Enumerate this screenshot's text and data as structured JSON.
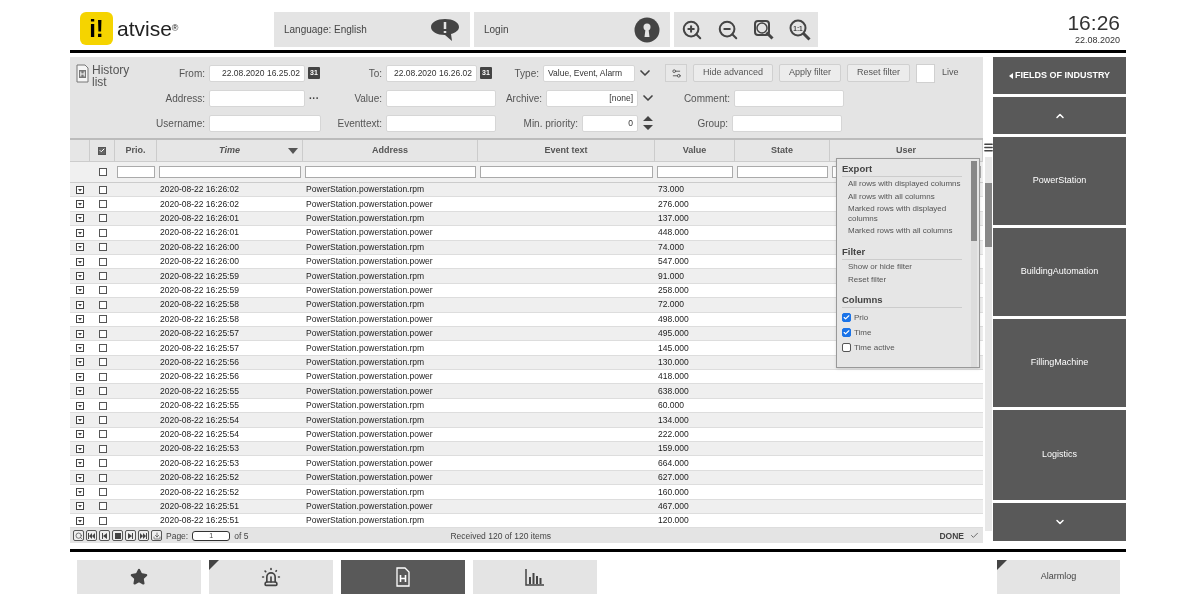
{
  "header": {
    "logo_mark": "i!",
    "logo_text": "atvise",
    "logo_reg": "®",
    "language": "Language: English",
    "login": "Login",
    "zoom_actual_label": "1:1",
    "time": "16:26",
    "date": "22.08.2020"
  },
  "history": {
    "title": "History list",
    "filters": {
      "from": {
        "label": "From:",
        "value": "22.08.2020 16.25.02",
        "calendar": "31"
      },
      "to": {
        "label": "To:",
        "value": "22.08.2020 16.26.02",
        "calendar": "31"
      },
      "type": {
        "label": "Type:",
        "value": "Value, Event, Alarm"
      },
      "address": {
        "label": "Address:",
        "button": "···"
      },
      "value": {
        "label": "Value:"
      },
      "archive": {
        "label": "Archive:",
        "value": "[none]"
      },
      "comment": {
        "label": "Comment:"
      },
      "username": {
        "label": "Username:"
      },
      "eventtext": {
        "label": "Eventtext:"
      },
      "min_priority": {
        "label": "Min. priority:",
        "value": "0"
      },
      "group": {
        "label": "Group:"
      }
    },
    "buttons": [
      "Hide advanced",
      "Apply filter",
      "Reset filter"
    ],
    "live": {
      "label": "Live",
      "checked": false
    }
  },
  "table": {
    "columns": [
      {
        "label": "Prio.",
        "sorted": false
      },
      {
        "label": "Time",
        "sorted": true
      },
      {
        "label": "Address",
        "sorted": false
      },
      {
        "label": "Event text",
        "sorted": false
      },
      {
        "label": "Value",
        "sorted": false
      },
      {
        "label": "State",
        "sorted": false
      },
      {
        "label": "User",
        "sorted": false
      }
    ],
    "header_checked": true,
    "filter_checked": false,
    "rows": [
      {
        "checked": false,
        "time": "2020-08-22 16:26:02",
        "address": "PowerStation.powerstation.rpm",
        "value": "73.000"
      },
      {
        "checked": false,
        "time": "2020-08-22 16:26:02",
        "address": "PowerStation.powerstation.power",
        "value": "276.000"
      },
      {
        "checked": false,
        "time": "2020-08-22 16:26:01",
        "address": "PowerStation.powerstation.rpm",
        "value": "137.000"
      },
      {
        "checked": false,
        "time": "2020-08-22 16:26:01",
        "address": "PowerStation.powerstation.power",
        "value": "448.000"
      },
      {
        "checked": false,
        "time": "2020-08-22 16:26:00",
        "address": "PowerStation.powerstation.rpm",
        "value": "74.000"
      },
      {
        "checked": false,
        "time": "2020-08-22 16:26:00",
        "address": "PowerStation.powerstation.power",
        "value": "547.000"
      },
      {
        "checked": false,
        "time": "2020-08-22 16:25:59",
        "address": "PowerStation.powerstation.rpm",
        "value": "91.000"
      },
      {
        "checked": false,
        "time": "2020-08-22 16:25:59",
        "address": "PowerStation.powerstation.power",
        "value": "258.000"
      },
      {
        "checked": false,
        "time": "2020-08-22 16:25:58",
        "address": "PowerStation.powerstation.rpm",
        "value": "72.000"
      },
      {
        "checked": false,
        "time": "2020-08-22 16:25:58",
        "address": "PowerStation.powerstation.power",
        "value": "498.000"
      },
      {
        "checked": false,
        "time": "2020-08-22 16:25:57",
        "address": "PowerStation.powerstation.power",
        "value": "495.000"
      },
      {
        "checked": false,
        "time": "2020-08-22 16:25:57",
        "address": "PowerStation.powerstation.rpm",
        "value": "145.000"
      },
      {
        "checked": false,
        "time": "2020-08-22 16:25:56",
        "address": "PowerStation.powerstation.rpm",
        "value": "130.000"
      },
      {
        "checked": false,
        "time": "2020-08-22 16:25:56",
        "address": "PowerStation.powerstation.power",
        "value": "418.000"
      },
      {
        "checked": false,
        "time": "2020-08-22 16:25:55",
        "address": "PowerStation.powerstation.power",
        "value": "638.000"
      },
      {
        "checked": false,
        "time": "2020-08-22 16:25:55",
        "address": "PowerStation.powerstation.rpm",
        "value": "60.000"
      },
      {
        "checked": false,
        "time": "2020-08-22 16:25:54",
        "address": "PowerStation.powerstation.rpm",
        "value": "134.000"
      },
      {
        "checked": false,
        "time": "2020-08-22 16:25:54",
        "address": "PowerStation.powerstation.power",
        "value": "222.000"
      },
      {
        "checked": false,
        "time": "2020-08-22 16:25:53",
        "address": "PowerStation.powerstation.rpm",
        "value": "159.000"
      },
      {
        "checked": false,
        "time": "2020-08-22 16:25:53",
        "address": "PowerStation.powerstation.power",
        "value": "664.000"
      },
      {
        "checked": false,
        "time": "2020-08-22 16:25:52",
        "address": "PowerStation.powerstation.power",
        "value": "627.000"
      },
      {
        "checked": false,
        "time": "2020-08-22 16:25:52",
        "address": "PowerStation.powerstation.rpm",
        "value": "160.000"
      },
      {
        "checked": false,
        "time": "2020-08-22 16:25:51",
        "address": "PowerStation.powerstation.power",
        "value": "467.000"
      },
      {
        "checked": false,
        "time": "2020-08-22 16:25:51",
        "address": "PowerStation.powerstation.rpm",
        "value": "120.000"
      }
    ],
    "footer": {
      "page_label": "Page:",
      "page": "1",
      "of": "of 5",
      "status": "Received 120 of 120 items",
      "done": "DONE"
    }
  },
  "menu": {
    "sections": [
      {
        "title": "Export",
        "items": [
          {
            "kind": "action",
            "label": "All rows with displayed columns"
          },
          {
            "kind": "action",
            "label": "All rows with all columns"
          },
          {
            "kind": "action",
            "label": "Marked rows with displayed columns"
          },
          {
            "kind": "action",
            "label": "Marked rows with all columns"
          }
        ]
      },
      {
        "title": "Filter",
        "items": [
          {
            "kind": "action",
            "label": "Show or hide filter"
          },
          {
            "kind": "action",
            "label": "Reset filter"
          }
        ]
      },
      {
        "title": "Columns",
        "items": [
          {
            "kind": "checkbox",
            "label": "Prio",
            "checked": true
          },
          {
            "kind": "checkbox",
            "label": "Time",
            "checked": true
          },
          {
            "kind": "checkbox",
            "label": "Time active",
            "checked": false
          }
        ]
      }
    ]
  },
  "sidebar": {
    "header": "FIELDS OF INDUSTRY",
    "items": [
      {
        "label": "PowerStation"
      },
      {
        "label": "BuildingAutomation"
      },
      {
        "label": "FillingMachine"
      },
      {
        "label": "Logistics"
      }
    ]
  },
  "bottom_nav": [
    {
      "kind": "star",
      "selected": false,
      "marker": false
    },
    {
      "kind": "alarm",
      "selected": false,
      "marker": true
    },
    {
      "kind": "history",
      "selected": true,
      "marker": false
    },
    {
      "kind": "chart",
      "selected": false,
      "marker": false
    }
  ],
  "alarmlog": {
    "label": "Alarmlog",
    "marker": true
  }
}
